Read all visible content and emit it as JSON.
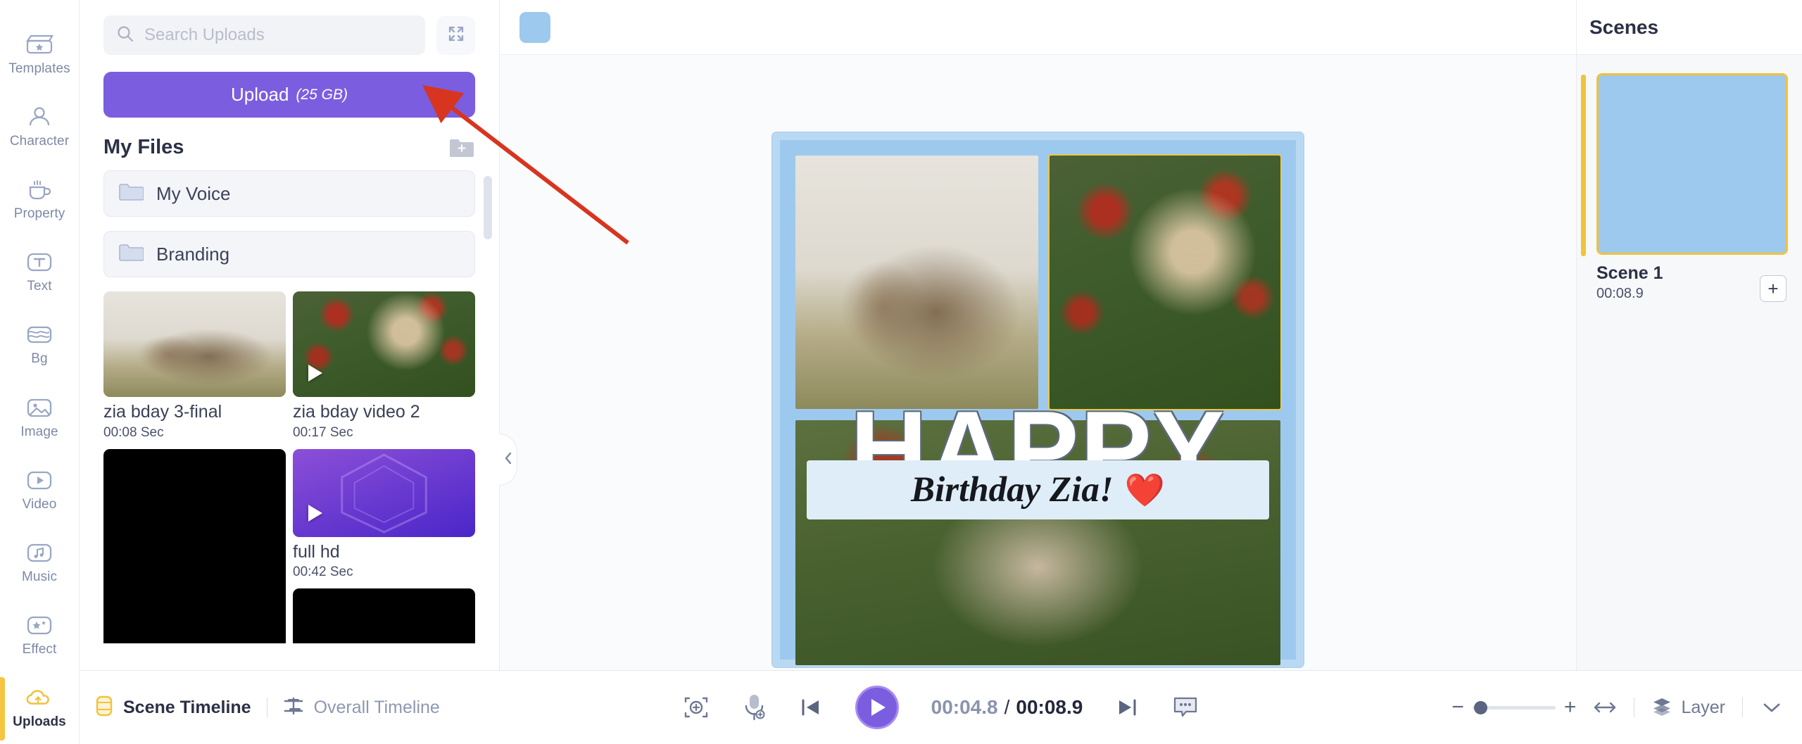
{
  "rail": {
    "items": [
      {
        "label": "Templates",
        "icon": "templates-icon",
        "active": false
      },
      {
        "label": "Character",
        "icon": "character-icon",
        "active": false
      },
      {
        "label": "Property",
        "icon": "property-icon",
        "active": false
      },
      {
        "label": "Text",
        "icon": "text-icon",
        "active": false
      },
      {
        "label": "Bg",
        "icon": "bg-icon",
        "active": false
      },
      {
        "label": "Image",
        "icon": "image-icon",
        "active": false
      },
      {
        "label": "Video",
        "icon": "video-icon",
        "active": false
      },
      {
        "label": "Music",
        "icon": "music-icon",
        "active": false
      },
      {
        "label": "Effect",
        "icon": "effect-icon",
        "active": false
      },
      {
        "label": "Uploads",
        "icon": "uploads-cloud-icon",
        "active": true
      }
    ]
  },
  "panel": {
    "search_placeholder": "Search Uploads",
    "search_value": "",
    "expand_icon": "expand-arrows-icon",
    "upload_label": "Upload",
    "upload_size": "(25 GB)",
    "files_title": "My Files",
    "add_folder_icon": "add-folder-icon",
    "folders": [
      {
        "name": "My Voice",
        "icon": "folder-icon"
      },
      {
        "name": "Branding",
        "icon": "folder-icon"
      }
    ],
    "media": [
      {
        "name": "zia bday 3-final",
        "duration": "00:08 Sec",
        "kind": "photo-mother-child"
      },
      {
        "name": "zia bday video 2",
        "duration": "00:17 Sec",
        "kind": "photo-girl-poppies"
      },
      {
        "name": "",
        "duration": "",
        "kind": "black"
      },
      {
        "name": "full hd",
        "duration": "00:42 Sec",
        "kind": "purple-hex"
      },
      {
        "name": "",
        "duration": "",
        "kind": "black"
      }
    ]
  },
  "stage": {
    "bg_swatch_color": "#9ec9ee",
    "collapse_icon": "chevron-left-icon",
    "collage": {
      "frame_color": "#b9d8f2",
      "headline": "HAPPY",
      "band_text": "Birthday Zia!",
      "band_emoji": "❤️",
      "band_bg": "#dfedf8"
    }
  },
  "scenes": {
    "title": "Scenes",
    "items": [
      {
        "name": "Scene 1",
        "duration": "00:08.9",
        "thumb_color": "#9ec9ee",
        "selected": true
      }
    ],
    "add_scene_label": "+"
  },
  "bottombar": {
    "scene_timeline_label": "Scene Timeline",
    "scene_timeline_icon": "scene-timeline-icon",
    "overall_timeline_label": "Overall Timeline",
    "overall_timeline_icon": "overall-timeline-icon",
    "fit_icon": "fit-to-screen-icon",
    "mic_icon": "microphone-record-icon",
    "prev_icon": "skip-previous-icon",
    "play_icon": "play-icon",
    "next_icon": "skip-next-icon",
    "subtitle_icon": "subtitle-bubble-icon",
    "time_current": "00:04.8",
    "time_separator": "/",
    "time_total": "00:08.9",
    "zoom_minus": "−",
    "zoom_plus": "+",
    "fit_width_icon": "fit-width-icon",
    "layer_label": "Layer",
    "layer_icon": "layers-icon",
    "chevron_icon": "chevron-down-icon"
  },
  "annotation": {
    "arrow_color": "#d7351f",
    "points_to": "upload-button"
  }
}
